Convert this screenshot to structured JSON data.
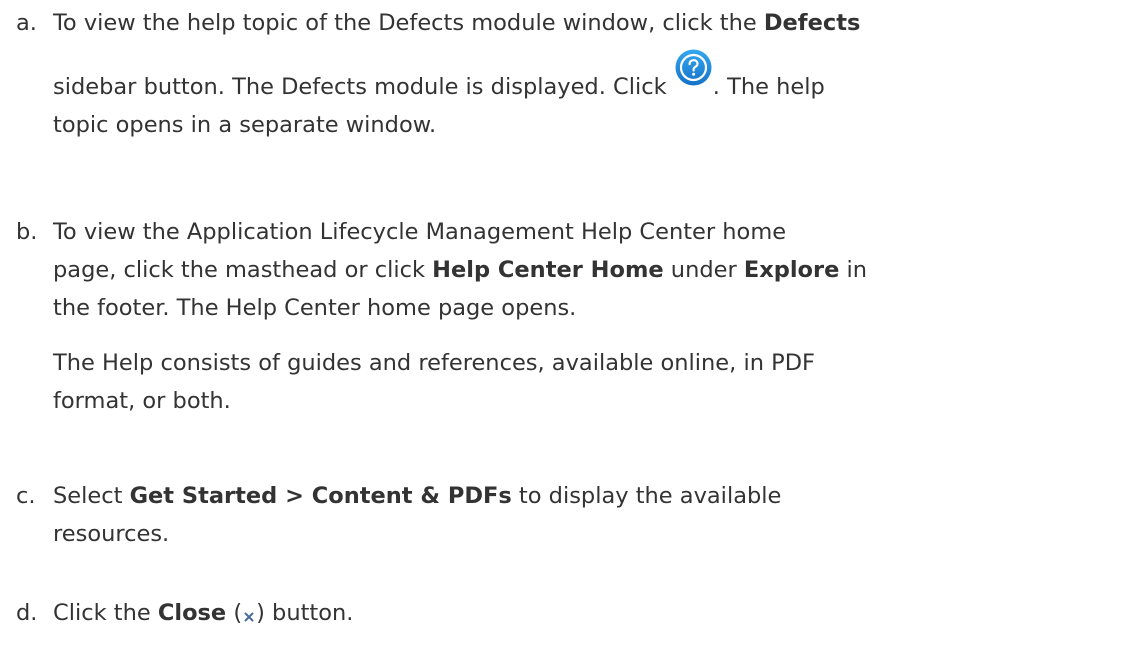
{
  "steps": [
    {
      "marker": "a.",
      "line1_pre": "To view the help topic of the Defects module window, click the ",
      "line1_bold": "Defects",
      "line2_pre": "sidebar button. The Defects module is displayed. Click ",
      "line2_post": ". The help",
      "line3": "topic opens in a separate window.",
      "icon": "help-question-icon"
    },
    {
      "marker": "b.",
      "line1": "To view the Application Lifecycle Management Help Center home",
      "line2_pre": "page, click the masthead or click ",
      "line2_bold1": "Help Center Home",
      "line2_mid": " under ",
      "line2_bold2": "Explore",
      "line2_post": " in",
      "line3": "the footer. The Help Center home page opens.",
      "note_line1": "The  Help consists of guides and references, available online, in PDF",
      "note_line2": "format, or both."
    },
    {
      "marker": "c.",
      "line1_pre": "Select ",
      "line1_bold": "Get Started > Content & PDFs",
      "line1_post": " to display the available",
      "line2": "resources."
    },
    {
      "marker": "d.",
      "line1_pre": "Click the ",
      "line1_bold": "Close",
      "line1_paren_open": " (",
      "line1_paren_close": ") button.",
      "icon": "close-x-icon"
    }
  ],
  "colors": {
    "text": "#333333",
    "help_icon_blue": "#1e8fe0",
    "close_icon": "#4a6c9a"
  }
}
